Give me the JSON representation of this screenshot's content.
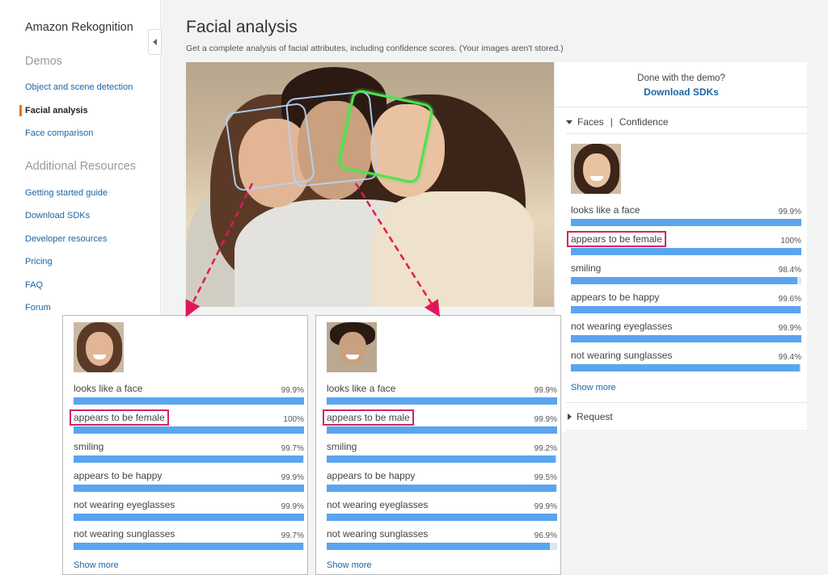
{
  "sidebar": {
    "brand": "Amazon Rekognition",
    "demos_title": "Demos",
    "demos": [
      "Object and scene detection",
      "Facial analysis",
      "Face comparison"
    ],
    "resources_title": "Additional Resources",
    "resources": [
      "Getting started guide",
      "Download SDKs",
      "Developer resources",
      "Pricing",
      "FAQ",
      "Forum"
    ]
  },
  "main": {
    "title": "Facial analysis",
    "subtitle": "Get a complete analysis of facial attributes, including confidence scores. (Your images aren't stored.)"
  },
  "panel": {
    "done_text": "Done with the demo?",
    "download_link": "Download SDKs",
    "faces_header": "Faces",
    "separator": "|",
    "confidence_header": "Confidence",
    "request_header": "Request",
    "show_more": "Show more"
  },
  "colors": {
    "accent_orange": "#ec7211",
    "link_blue": "#1d64a6",
    "bar_blue": "#5aa5ef",
    "highlight_pink": "#d6245e",
    "selected_face_green": "#4fe24f"
  },
  "faces": [
    {
      "attributes": [
        {
          "label": "looks like a face",
          "value": "99.9%",
          "fill": 99.9
        },
        {
          "label": "appears to be female",
          "value": "100%",
          "fill": 100,
          "highlight": true
        },
        {
          "label": "smiling",
          "value": "98.4%",
          "fill": 98.4
        },
        {
          "label": "appears to be happy",
          "value": "99.6%",
          "fill": 99.6
        },
        {
          "label": "not wearing eyeglasses",
          "value": "99.9%",
          "fill": 99.9
        },
        {
          "label": "not wearing sunglasses",
          "value": "99.4%",
          "fill": 99.4
        }
      ]
    },
    {
      "attributes": [
        {
          "label": "looks like a face",
          "value": "99.9%",
          "fill": 99.9
        },
        {
          "label": "appears to be female",
          "value": "100%",
          "fill": 100,
          "highlight": true
        },
        {
          "label": "smiling",
          "value": "99.7%",
          "fill": 99.7
        },
        {
          "label": "appears to be happy",
          "value": "99.9%",
          "fill": 99.9
        },
        {
          "label": "not wearing eyeglasses",
          "value": "99.9%",
          "fill": 99.9
        },
        {
          "label": "not wearing sunglasses",
          "value": "99.7%",
          "fill": 99.7
        }
      ]
    },
    {
      "attributes": [
        {
          "label": "looks like a face",
          "value": "99.9%",
          "fill": 99.9
        },
        {
          "label": "appears to be male",
          "value": "99.9%",
          "fill": 99.9,
          "highlight": true
        },
        {
          "label": "smiling",
          "value": "99.2%",
          "fill": 99.2
        },
        {
          "label": "appears to be happy",
          "value": "99.5%",
          "fill": 99.5
        },
        {
          "label": "not wearing eyeglasses",
          "value": "99.9%",
          "fill": 99.9
        },
        {
          "label": "not wearing sunglasses",
          "value": "96.9%",
          "fill": 96.9
        }
      ]
    }
  ]
}
